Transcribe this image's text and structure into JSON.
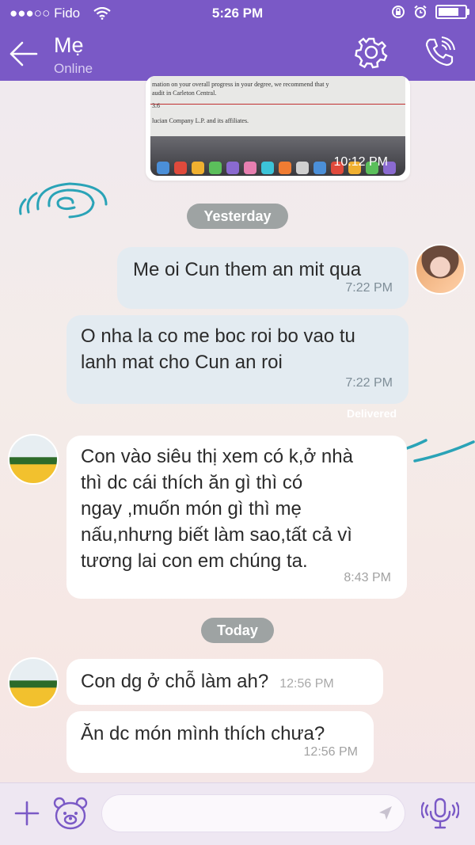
{
  "status_bar": {
    "carrier": "●●●○○ Fido",
    "time": "5:26 PM",
    "battery_level": 0.9
  },
  "header": {
    "contact_name": "Mẹ",
    "contact_status": "Online",
    "icons": [
      "back-arrow-icon",
      "gear-icon",
      "phone-call-icon"
    ]
  },
  "image_message": {
    "doc_lines": [
      "mation on your overall progress in your degree, we recommend that y",
      "audit in Carleton Central.",
      "3.6",
      "lucian Company L.P. and its affiliates."
    ],
    "time": "10:12 PM"
  },
  "date_separators": {
    "yesterday": "Yesterday",
    "today": "Today"
  },
  "messages": {
    "m1": {
      "text": "Me oi Cun them an mit qua",
      "time": "7:22 PM"
    },
    "m2": {
      "line1": "O nha la co me boc roi bo vao tu",
      "line2": "lanh mat cho Cun an roi",
      "time": "7:22 PM"
    },
    "delivered": "Delivered",
    "m3": {
      "line1": "Con vào siêu thị xem có k,ở nhà",
      "line2": "thì dc cái thích ăn gì thì có",
      "line3": "ngay ,muốn món gì thì mẹ",
      "line4": "nấu,nhưng biết làm sao,tất cả vì",
      "line5": "tương lai con em chúng ta.",
      "time": "8:43 PM"
    },
    "m4": {
      "text": "Con dg ở chỗ làm ah?",
      "time": "12:56 PM"
    },
    "m5": {
      "text": "Ăn dc món mình thích chưa?",
      "time": "12:56 PM"
    }
  },
  "input_bar": {
    "icons": [
      "plus-icon",
      "sticker-bear-icon",
      "send-icon",
      "voice-message-icon"
    ],
    "placeholder": ""
  },
  "colors": {
    "header": "#7a59c6",
    "outgoing_bubble": "#e3ebf1",
    "incoming_bubble": "#ffffff",
    "date_pill": "#9ea3a3",
    "accent_teal": "#2aa3b7"
  }
}
